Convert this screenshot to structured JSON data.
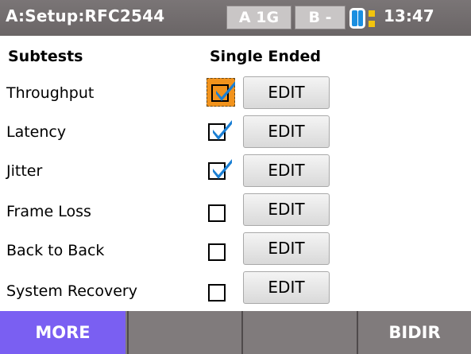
{
  "header": {
    "title": "A:Setup:RFC2544",
    "port_a": "A 1G",
    "port_b": "B -",
    "clock": "13:47",
    "battery_icon": "battery-icon",
    "connector_icon": "connector-icon"
  },
  "columns": {
    "subtests": "Subtests",
    "single_ended": "Single Ended"
  },
  "rows": [
    {
      "label": "Throughput",
      "checked": true,
      "focused": true,
      "edit": "EDIT"
    },
    {
      "label": "Latency",
      "checked": true,
      "focused": false,
      "edit": "EDIT"
    },
    {
      "label": "Jitter",
      "checked": true,
      "focused": false,
      "edit": "EDIT"
    },
    {
      "label": "Frame Loss",
      "checked": false,
      "focused": false,
      "edit": "EDIT"
    },
    {
      "label": "Back to Back",
      "checked": false,
      "focused": false,
      "edit": "EDIT"
    },
    {
      "label": "System Recovery",
      "checked": false,
      "focused": false,
      "edit": "EDIT"
    }
  ],
  "footer": {
    "key1": "MORE",
    "key2": "",
    "key3": "",
    "key4": "BIDIR"
  },
  "colors": {
    "header_bg": "#6a6566",
    "check_blue": "#1a7fd4",
    "focus_orange": "#f2931c",
    "more_key": "#7a5ff2"
  }
}
